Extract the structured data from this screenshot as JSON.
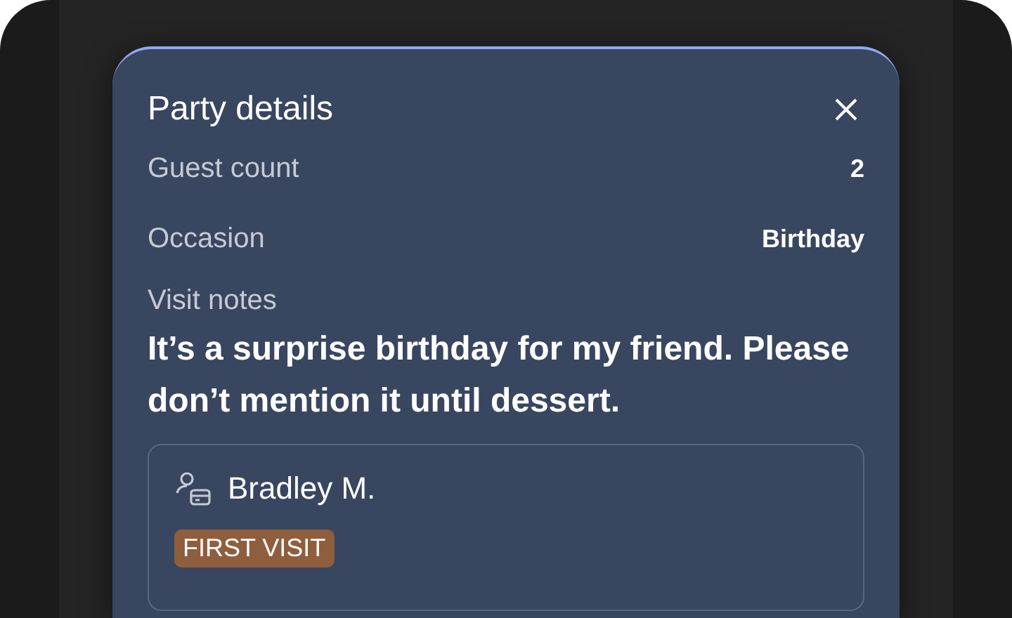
{
  "sheet": {
    "title": "Party details",
    "details": [
      {
        "label": "Guest count",
        "value": "2"
      },
      {
        "label": "Occasion",
        "value": "Birthday"
      }
    ],
    "notes": {
      "label": "Visit notes",
      "text": "It’s a surprise birthday for my friend. Please don’t mention it until dessert."
    },
    "guest": {
      "name": "Bradley M.",
      "tag": {
        "label": "FIRST VISIT",
        "color": "#8f5e3c"
      }
    }
  }
}
